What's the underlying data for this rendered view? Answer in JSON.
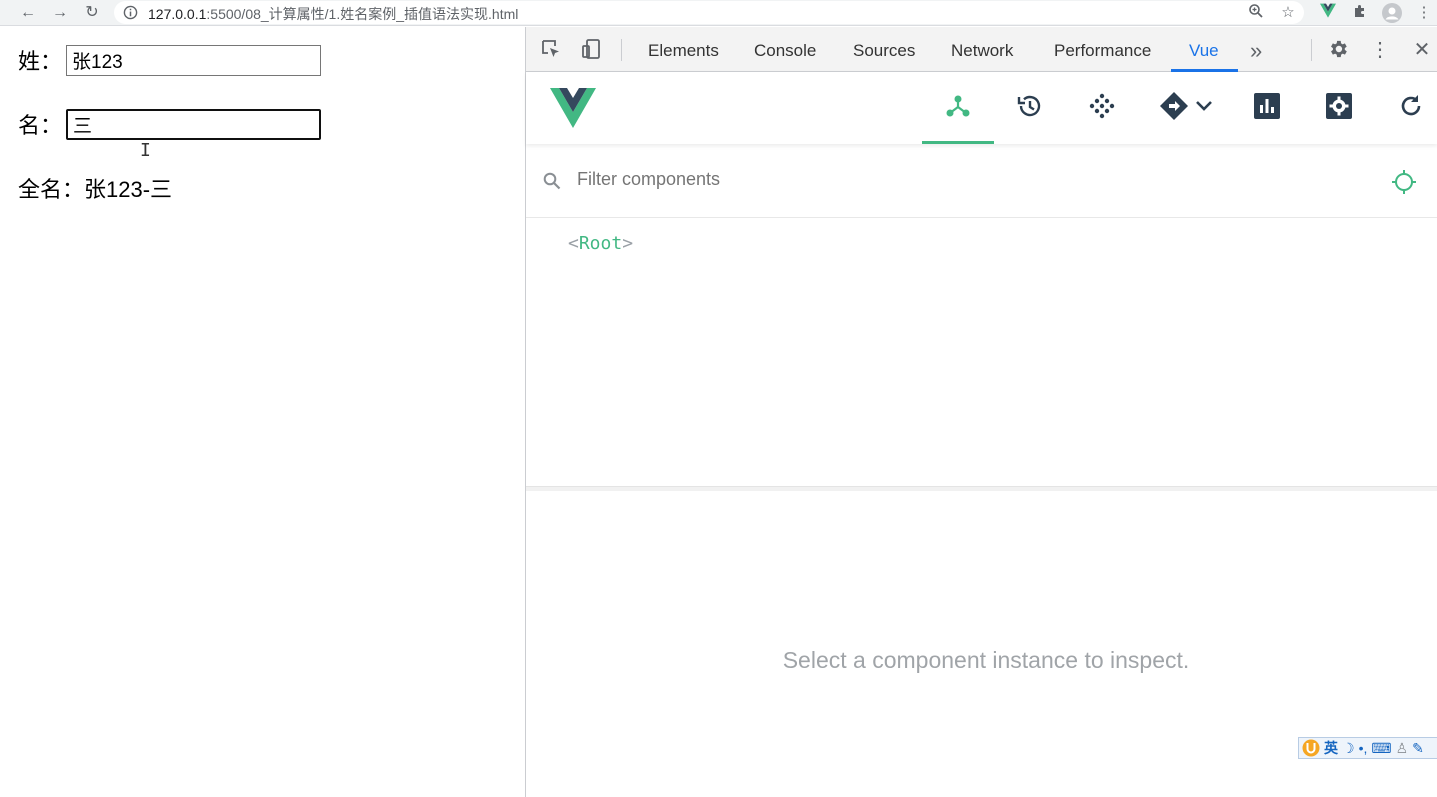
{
  "browser": {
    "url_host": "127.0.0.1",
    "url_rest": ":5500/08_计算属性/1.姓名案例_插值语法实现.html"
  },
  "page": {
    "last_name_label": "姓：",
    "last_name_value": "张123",
    "first_name_label": "名：",
    "first_name_value": "三",
    "full_name_text": "全名：张123-三"
  },
  "devtools": {
    "tabs": [
      {
        "label": "Elements"
      },
      {
        "label": "Console"
      },
      {
        "label": "Sources"
      },
      {
        "label": "Network"
      },
      {
        "label": "Performance"
      },
      {
        "label": "Vue"
      }
    ],
    "active_tab": "Vue",
    "more_tabs_icon": "»"
  },
  "vue_devtools": {
    "filter_placeholder": "Filter components",
    "tree": {
      "open_bracket": "<",
      "root_name": "Root",
      "close_bracket": ">"
    },
    "empty_message": "Select a component instance to inspect.",
    "accent_color": "#42b883",
    "icon_color": "#2c3e50"
  },
  "ime_bar": {
    "mode_label": "英"
  }
}
